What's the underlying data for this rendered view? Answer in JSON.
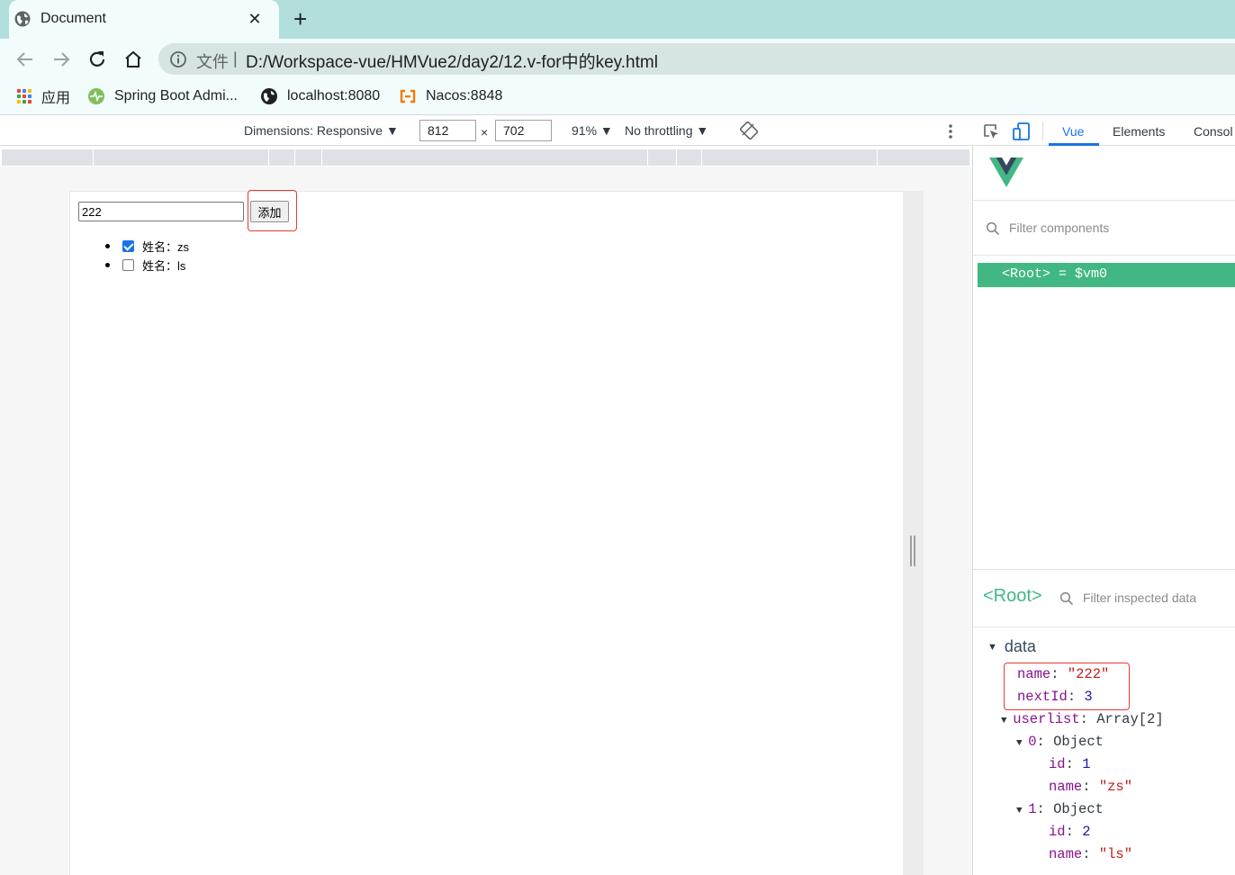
{
  "browser": {
    "tab_title": "Document",
    "tab_close": "✕",
    "new_tab": "+",
    "address": {
      "file_label": "文件",
      "separator": "|",
      "url": "D:/Workspace-vue/HMVue2/day2/12.v-for中的key.html"
    },
    "bookmarks": [
      {
        "label": "应用"
      },
      {
        "label": "Spring Boot Admi..."
      },
      {
        "label": "localhost:8080"
      },
      {
        "label": "Nacos:8848"
      }
    ]
  },
  "device_toolbar": {
    "dimensions": "Dimensions: Responsive ▼",
    "width": "812",
    "times": "×",
    "height": "702",
    "zoom": "91% ▼",
    "throttling": "No throttling ▼"
  },
  "page": {
    "input_value": "222",
    "add_button": "添加",
    "users": [
      {
        "label": "姓名：zs",
        "checked": true
      },
      {
        "label": "姓名：ls",
        "checked": false
      }
    ]
  },
  "devtools": {
    "tabs": [
      "Vue",
      "Elements",
      "Consol"
    ],
    "active_tab": "Vue",
    "filter_components_placeholder": "Filter components",
    "root_row": "<Root> = $vm0",
    "inspect_title": "<Root>",
    "filter_inspected_placeholder": "Filter inspected data",
    "tree": {
      "section": "data",
      "name_key": "name",
      "name_val": "\"222\"",
      "nextId_key": "nextId",
      "nextId_val": "3",
      "userlist_key": "userlist",
      "userlist_val": "Array[2]",
      "item0_key": "0",
      "item0_val": "Object",
      "item0_id_key": "id",
      "item0_id_val": "1",
      "item0_name_key": "name",
      "item0_name_val": "\"zs\"",
      "item1_key": "1",
      "item1_val": "Object",
      "item1_id_key": "id",
      "item1_id_val": "2",
      "item1_name_key": "name",
      "item1_name_val": "\"ls\""
    }
  },
  "colors": {
    "vue_green": "#41b883",
    "highlight_red": "#e53935",
    "chrome_teal": "#b2dfdb"
  }
}
